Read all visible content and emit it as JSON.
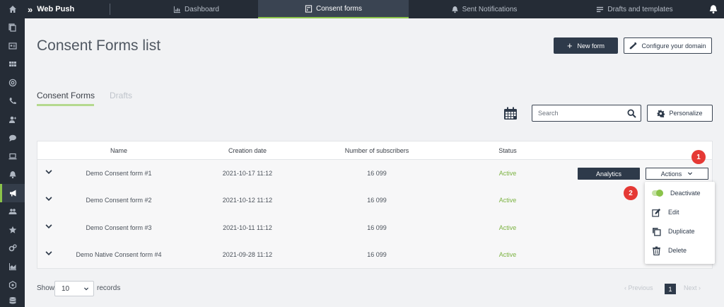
{
  "app": {
    "title": "Web Push"
  },
  "topnav": {
    "tabs": [
      {
        "label": "Dashboard",
        "icon": "chart-icon"
      },
      {
        "label": "Consent forms",
        "icon": "form-icon"
      },
      {
        "label": "Sent Notifications",
        "icon": "bell-icon"
      },
      {
        "label": "Drafts and templates",
        "icon": "list-icon"
      }
    ],
    "active_tab": "Consent forms"
  },
  "sidebar": {
    "items": [
      "home-icon",
      "copy-icon",
      "id-card-icon",
      "grid-icon",
      "at-icon",
      "phone-icon",
      "user-plus-icon",
      "chat-icon",
      "laptop-icon",
      "bell-icon",
      "megaphone-icon",
      "users-icon",
      "star-icon",
      "cogs-icon",
      "chart-area-icon",
      "hexagon-icon",
      "database-icon"
    ],
    "active": "megaphone-icon"
  },
  "page": {
    "title": "Consent Forms list",
    "new_form_label": "New form",
    "configure_domain_label": "Configure your domain"
  },
  "subtabs": {
    "consent_forms": "Consent Forms",
    "drafts": "Drafts"
  },
  "toolbar": {
    "search_placeholder": "Search",
    "personalize_label": "Personalize"
  },
  "table": {
    "columns": [
      "Name",
      "Creation date",
      "Number of subscribers",
      "Status"
    ],
    "rows": [
      {
        "name": "Demo Consent form #1",
        "date": "2021-10-17 11:12",
        "subscribers": "16 099",
        "status": "Active"
      },
      {
        "name": "Demo Consent form #2",
        "date": "2021-10-12 11:12",
        "subscribers": "16 099",
        "status": "Active"
      },
      {
        "name": "Demo Consent form #3",
        "date": "2021-10-11 11:12",
        "subscribers": "16 099",
        "status": "Active"
      },
      {
        "name": "Demo Native Consent form #4",
        "date": "2021-09-28 11:12",
        "subscribers": "16 099",
        "status": "Active"
      }
    ],
    "analytics_label": "Analytics",
    "actions_label": "Actions"
  },
  "actions_menu": {
    "deactivate": "Deactivate",
    "edit": "Edit",
    "duplicate": "Duplicate",
    "delete": "Delete"
  },
  "callouts": {
    "first": "1",
    "second": "2"
  },
  "footer": {
    "show_label": "Show",
    "records_value": "10",
    "records_label": "records",
    "previous_label": "Previous",
    "page": "1",
    "next_label": "Next"
  },
  "colors": {
    "accent": "#8bc34a",
    "primary": "#2e3a4a",
    "status_active": "#7cb342",
    "callout": "#e53935"
  }
}
